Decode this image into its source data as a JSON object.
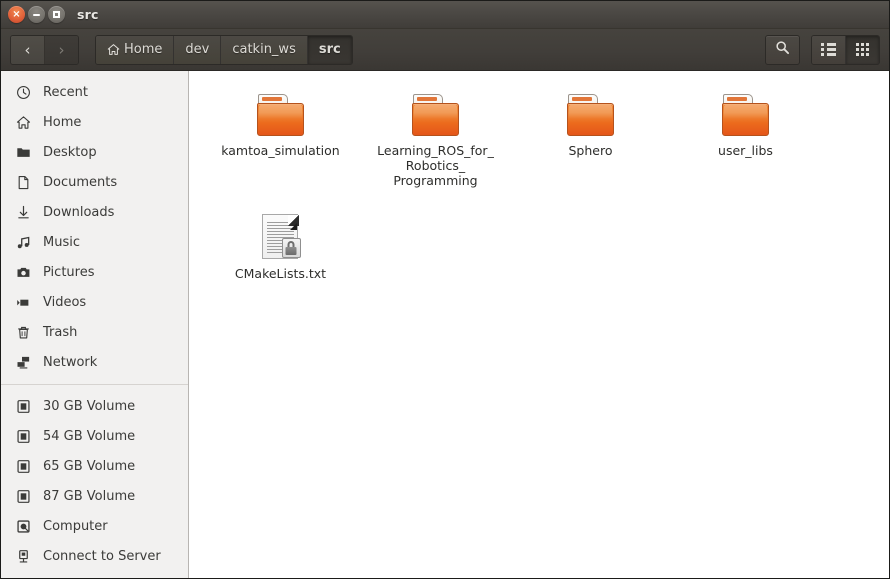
{
  "window": {
    "title": "src",
    "controls": [
      {
        "name": "close",
        "glyph": "×"
      },
      {
        "name": "minimize",
        "glyph": ""
      },
      {
        "name": "maximize",
        "glyph": ""
      }
    ]
  },
  "toolbar": {
    "back_label": "‹",
    "forward_label": "›",
    "search_icon": "search-icon",
    "view_list_icon": "list-view-icon",
    "view_grid_icon": "grid-view-icon",
    "breadcrumbs": [
      {
        "label": "Home",
        "icon": "home-icon",
        "active": false
      },
      {
        "label": "dev",
        "icon": "",
        "active": false
      },
      {
        "label": "catkin_ws",
        "icon": "",
        "active": false
      },
      {
        "label": "src",
        "icon": "",
        "active": true
      }
    ]
  },
  "sidebar": {
    "groups": [
      {
        "items": [
          {
            "label": "Recent",
            "icon": "clock-icon"
          },
          {
            "label": "Home",
            "icon": "home-icon"
          },
          {
            "label": "Desktop",
            "icon": "folder-icon"
          },
          {
            "label": "Documents",
            "icon": "document-icon"
          },
          {
            "label": "Downloads",
            "icon": "download-icon"
          },
          {
            "label": "Music",
            "icon": "music-note-icon"
          },
          {
            "label": "Pictures",
            "icon": "camera-icon"
          },
          {
            "label": "Videos",
            "icon": "video-camera-icon"
          },
          {
            "label": "Trash",
            "icon": "trash-icon"
          },
          {
            "label": "Network",
            "icon": "network-icon"
          }
        ]
      },
      {
        "items": [
          {
            "label": "30 GB Volume",
            "icon": "drive-icon"
          },
          {
            "label": "54 GB Volume",
            "icon": "drive-icon"
          },
          {
            "label": "65 GB Volume",
            "icon": "drive-icon"
          },
          {
            "label": "87 GB Volume",
            "icon": "drive-icon"
          },
          {
            "label": "Computer",
            "icon": "computer-icon"
          },
          {
            "label": "Connect to Server",
            "icon": "server-icon"
          }
        ]
      }
    ]
  },
  "files": {
    "items": [
      {
        "name": "kamtoa_simulation",
        "type": "folder"
      },
      {
        "name": "Learning_ROS_for_\nRobotics_\nProgramming",
        "type": "folder"
      },
      {
        "name": "Sphero",
        "type": "folder"
      },
      {
        "name": "user_libs",
        "type": "folder"
      },
      {
        "name": "CMakeLists.txt",
        "type": "text-file-locked"
      }
    ]
  },
  "colors": {
    "folder_orange": "#ec6a1c",
    "titlebar_dark": "#403d39",
    "sidebar_bg": "#f2f1f0",
    "close_button": "#e2623a"
  }
}
